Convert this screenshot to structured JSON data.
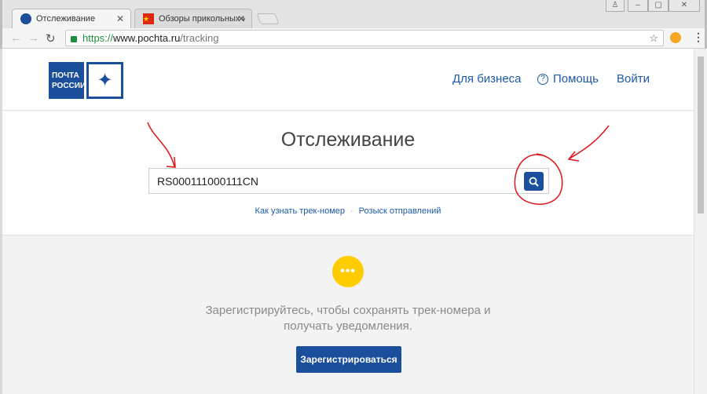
{
  "browser": {
    "tabs": [
      {
        "label": "Отслеживание",
        "active": true
      },
      {
        "label": "Обзоры прикольных и нео",
        "active": false
      }
    ],
    "url": {
      "scheme": "https://",
      "host": "www.pochta.ru",
      "path": "/tracking"
    }
  },
  "header": {
    "logo_line1": "ПОЧТА",
    "logo_line2": "РОССИИ",
    "nav": {
      "business": "Для бизнеса",
      "help": "Помощь",
      "login": "Войти"
    }
  },
  "tracking": {
    "title": "Отслеживание",
    "input_value": "RS000111000111CN",
    "link_how": "Как узнать трек-номер",
    "link_search": "Розыск отправлений"
  },
  "promo": {
    "bubble": "•••",
    "line1": "Зарегистрируйтесь, чтобы сохранять трек-номера и",
    "line2": "получать уведомления.",
    "button": "Зарегистрироваться"
  },
  "colors": {
    "brand": "#1b4f9c",
    "accent": "#ffcc00",
    "annotation": "#e0151a"
  }
}
